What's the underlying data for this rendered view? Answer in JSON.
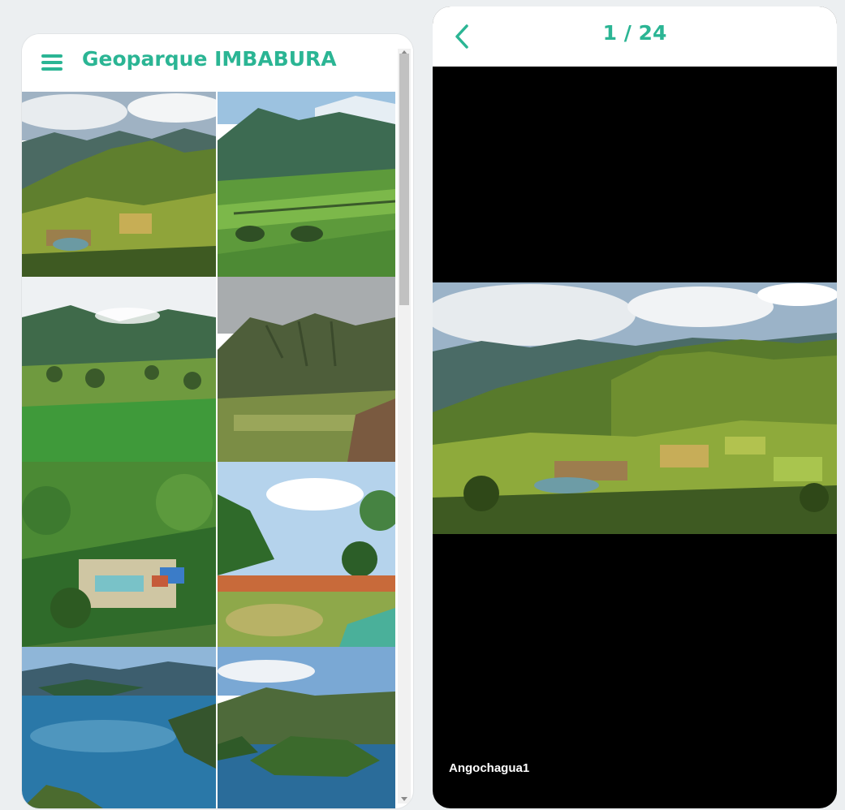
{
  "gallery": {
    "title": "Geoparque IMBABURA",
    "menu_icon": "hamburger-menu-icon",
    "accent": "#2bb594",
    "thumbnails": [
      {
        "scene": "andean-valley"
      },
      {
        "scene": "green-valley-fields"
      },
      {
        "scene": "misty-valley-meadow"
      },
      {
        "scene": "grey-sky-hills"
      },
      {
        "scene": "jungle-resort"
      },
      {
        "scene": "pool-palms"
      },
      {
        "scene": "crater-lake"
      },
      {
        "scene": "lake-islands"
      }
    ]
  },
  "viewer": {
    "counter": "1 / 24",
    "back_icon": "chevron-left-icon",
    "caption": "Angochagua1",
    "background": "#000000"
  }
}
